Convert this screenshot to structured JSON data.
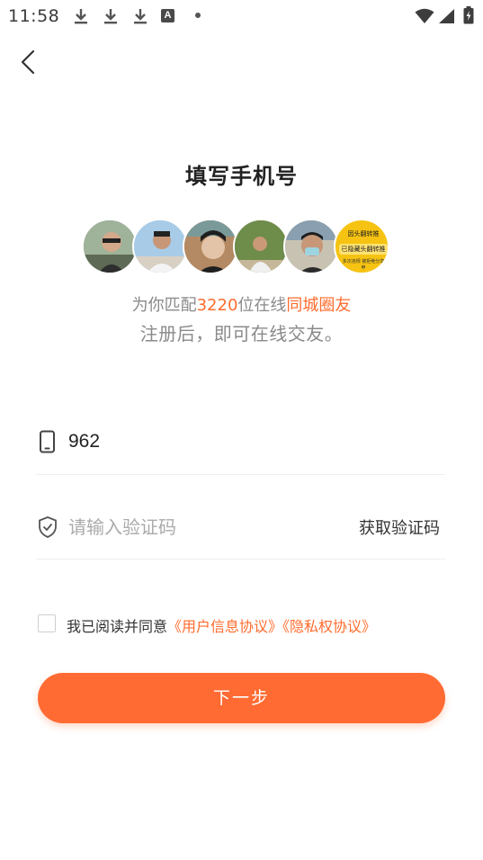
{
  "status_bar": {
    "time": "11:58",
    "icons": [
      "download-icon",
      "download-icon",
      "download-icon",
      "a-notification-icon",
      "dot-icon",
      "wifi-icon",
      "signal-icon",
      "battery-charging-icon"
    ],
    "a_label": "A"
  },
  "header": {
    "back_icon": "chevron-left-icon",
    "title": "填写手机号"
  },
  "avatars": [
    {
      "name": "avatar-1",
      "bg": "#6f8b78"
    },
    {
      "name": "avatar-2",
      "bg": "#8fb6d8"
    },
    {
      "name": "avatar-3",
      "bg": "#9c6f4d"
    },
    {
      "name": "avatar-4",
      "bg": "#5f7f3f"
    },
    {
      "name": "avatar-5",
      "bg": "#a6a092"
    },
    {
      "name": "avatar-6",
      "bg": "#f6c312"
    }
  ],
  "avatar_badge": {
    "line1": "因头翻转推",
    "line2": "已隐藏头翻转推",
    "line3": "多次违规\n被拒绝分享申",
    "color": "#f6c312"
  },
  "match": {
    "prefix": "为你匹配",
    "count": "3220",
    "middle": "位在线",
    "highlight": "同城圈友",
    "subtitle": "注册后，即可在线交友。"
  },
  "form": {
    "phone_icon": "phone-icon",
    "phone_value": "962",
    "code_icon": "shield-check-icon",
    "code_placeholder": "请输入验证码",
    "get_code_label": "获取验证码"
  },
  "agreement": {
    "checked": false,
    "text": "我已阅读并同意",
    "user_agreement": "《用户信息协议》",
    "privacy_agreement": "《隐私权协议》"
  },
  "next_button": "下一步",
  "colors": {
    "accent": "#ff6b33",
    "text_gray": "#8a8a8a"
  }
}
